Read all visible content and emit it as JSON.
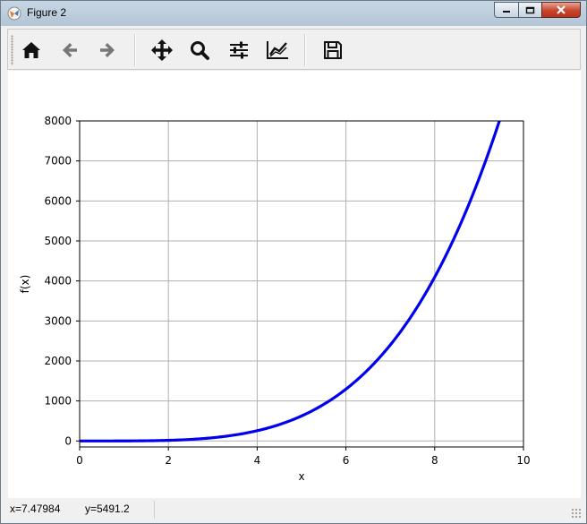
{
  "window": {
    "title": "Figure 2"
  },
  "toolbar": {
    "items": [
      {
        "icon": "home-icon"
      },
      {
        "icon": "back-arrow-icon"
      },
      {
        "icon": "forward-arrow-icon"
      },
      {
        "icon": "pan-move-icon"
      },
      {
        "icon": "zoom-magnifier-icon"
      },
      {
        "icon": "subplots-sliders-icon"
      },
      {
        "icon": "edit-axis-lines-icon"
      },
      {
        "icon": "save-floppy-icon"
      }
    ]
  },
  "status": {
    "x": "x=7.47984",
    "y": "y=5491.2"
  },
  "colors": {
    "line": "#0000ee",
    "grid": "#b0b0b0",
    "titlebar": "#bccbd9",
    "close_button": "#c7462b"
  },
  "chart_data": {
    "type": "line",
    "function": "f(x) = x^4",
    "x": [
      0,
      0.5,
      1,
      1.5,
      2,
      2.5,
      3,
      3.5,
      4,
      4.5,
      5,
      5.5,
      6,
      6.5,
      7,
      7.5,
      8,
      8.5,
      9,
      9.5
    ],
    "series": [
      {
        "values": [
          0,
          0.06,
          1,
          5.06,
          16,
          39.06,
          81,
          150.06,
          256,
          410.06,
          625,
          915.06,
          1296,
          1785.06,
          2401,
          3164.06,
          4096,
          5220.06,
          6561,
          8145.06
        ]
      }
    ],
    "xlabel": "x",
    "ylabel": "f(x)",
    "xlim": [
      0,
      10
    ],
    "ylim": [
      -150,
      8000
    ],
    "xticks": [
      "0",
      "2",
      "4",
      "6",
      "8",
      "10"
    ],
    "yticks": [
      "0",
      "1000",
      "2000",
      "3000",
      "4000",
      "5000",
      "6000",
      "7000",
      "8000"
    ],
    "grid": true
  }
}
